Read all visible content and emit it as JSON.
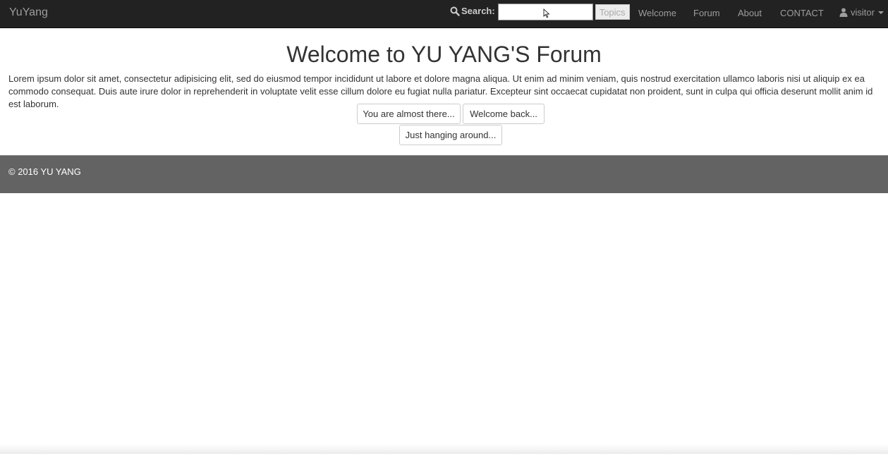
{
  "navbar": {
    "brand": "YuYang",
    "search": {
      "icon": "search-icon",
      "label": "Search:",
      "value": "",
      "placeholder": "",
      "button_label": "Topics"
    },
    "links": [
      {
        "label": "Welcome"
      },
      {
        "label": "Forum"
      },
      {
        "label": "About"
      },
      {
        "label": "CONTACT"
      }
    ],
    "user": {
      "icon": "user-icon",
      "label": "visitor"
    }
  },
  "main": {
    "title": "Welcome to YU YANG'S Forum",
    "intro": "Lorem ipsum dolor sit amet, consectetur adipisicing elit, sed do eiusmod tempor incididunt ut labore et dolore magna aliqua. Ut enim ad minim veniam, quis nostrud exercitation ullamco laboris nisi ut aliquip ex ea commodo consequat. Duis aute irure dolor in reprehenderit in voluptate velit esse cillum dolore eu fugiat nulla pariatur. Excepteur sint occaecat cupidatat non proident, sunt in culpa qui officia deserunt mollit anim id est laborum.",
    "buttons": [
      {
        "label": "You are almost there..."
      },
      {
        "label": "Welcome back..."
      },
      {
        "label": "Just hanging around..."
      }
    ]
  },
  "footer": {
    "copyright": "© 2016 YU YANG"
  },
  "colors": {
    "navbar_bg": "#222222",
    "navbar_text": "#9d9d9d",
    "footer_bg": "#636363",
    "footer_text": "#ffffff"
  }
}
